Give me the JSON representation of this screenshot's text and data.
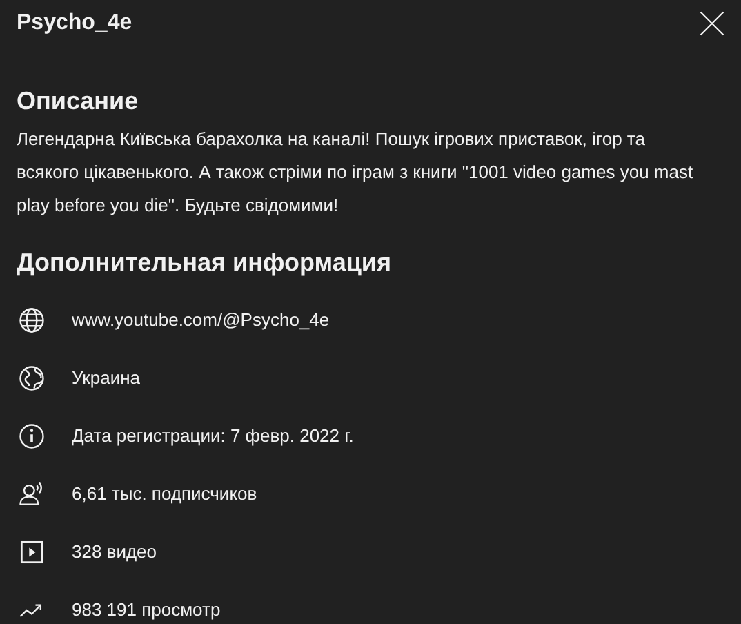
{
  "title": "Psycho_4e",
  "description": {
    "heading": "Описание",
    "text": "Легендарна Київська барахолка на каналі! Пошук ігрових приставок, ігор та всякого цікавенького. А також стріми по іграм з книги \"1001 video games you mast play before you die\". Будьте свідомими!"
  },
  "details": {
    "heading": "Дополнительная информация",
    "items": [
      {
        "kind": "link",
        "text": "www.youtube.com/@Psycho_4e"
      },
      {
        "kind": "country",
        "text": "Украина"
      },
      {
        "kind": "joined",
        "text": "Дата регистрации: 7 февр. 2022 г."
      },
      {
        "kind": "subscribers",
        "text": "6,61 тыс. подписчиков"
      },
      {
        "kind": "videos",
        "text": "328 видео"
      },
      {
        "kind": "views",
        "text": "983 191 просмотр"
      }
    ]
  }
}
